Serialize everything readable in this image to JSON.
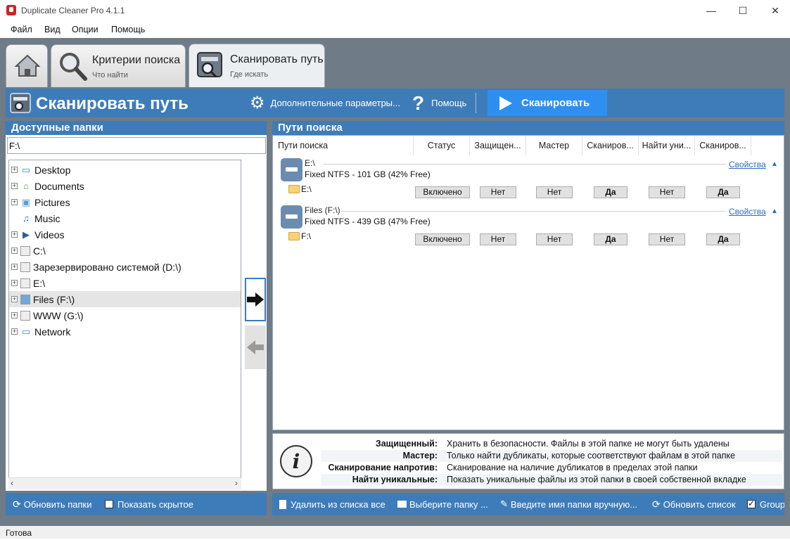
{
  "window": {
    "title": "Duplicate Cleaner Pro 4.1.1",
    "controls": [
      "minimize",
      "maximize",
      "close"
    ]
  },
  "menu": [
    "Файл",
    "Вид",
    "Опции",
    "Помощь"
  ],
  "tabs": [
    {
      "id": "home",
      "icon": "home-icon"
    },
    {
      "id": "criteria",
      "title": "Критерии поиска",
      "subtitle": "Что найти",
      "icon": "magnifier-icon"
    },
    {
      "id": "scan",
      "title": "Сканировать путь",
      "subtitle": "Где искать",
      "icon": "scan-drive-icon",
      "active": true
    }
  ],
  "header": {
    "title": "Сканировать путь",
    "advanced": "Дополнительные параметры...",
    "help": "Помощь",
    "scan": "Сканировать"
  },
  "left": {
    "heading": "Доступные папки",
    "path_value": "F:\\",
    "tree": [
      {
        "label": "Desktop",
        "icon": "desktop-icon",
        "expandable": true
      },
      {
        "label": "Documents",
        "icon": "documents-icon",
        "expandable": true
      },
      {
        "label": "Pictures",
        "icon": "pictures-icon",
        "expandable": true
      },
      {
        "label": "Music",
        "icon": "music-icon",
        "expandable": false
      },
      {
        "label": "Videos",
        "icon": "videos-icon",
        "expandable": true
      },
      {
        "label": "C:\\",
        "icon": "drive-icon",
        "expandable": true
      },
      {
        "label": "Зарезервировано системой (D:\\)",
        "icon": "drive-icon",
        "expandable": true
      },
      {
        "label": "E:\\",
        "icon": "drive-icon",
        "expandable": true
      },
      {
        "label": "Files (F:\\)",
        "icon": "drive-icon",
        "expandable": true,
        "selected": true
      },
      {
        "label": "WWW (G:\\)",
        "icon": "drive-icon",
        "expandable": true
      },
      {
        "label": "Network",
        "icon": "network-icon",
        "expandable": true
      }
    ]
  },
  "right": {
    "heading": "Пути поиска",
    "columns": [
      "Пути поиска",
      "Статус",
      "Защищен...",
      "Мастер",
      "Сканиров...",
      "Найти уни...",
      "Сканиров..."
    ],
    "drives": [
      {
        "name": "E:\\",
        "info": "Fixed NTFS - 101 GB (42% Free)",
        "props": "Свойства",
        "folder": "E:\\",
        "status": "Включено",
        "protected": "Нет",
        "master": "Нет",
        "scan_against": "Да",
        "find_unique": "Нет",
        "scan_last": "Да"
      },
      {
        "name": "Files (F:\\)",
        "info": "Fixed NTFS - 439 GB (47% Free)",
        "props": "Свойства",
        "folder": "F:\\",
        "status": "Включено",
        "protected": "Нет",
        "master": "Нет",
        "scan_against": "Да",
        "find_unique": "Нет",
        "scan_last": "Да"
      }
    ]
  },
  "info": [
    {
      "label": "Защищенный:",
      "text": "Хранить в безопасности. Файлы в этой папке не могут быть удалены"
    },
    {
      "label": "Мастер:",
      "text": "Только найти дубликаты, которые соответствуют файлам в этой папке"
    },
    {
      "label": "Сканирование напротив:",
      "text": "Сканирование на наличие дубликатов в пределах этой папки"
    },
    {
      "label": "Найти уникальные:",
      "text": "Показать уникальные файлы из этой папки в своей собственной вкладке"
    }
  ],
  "bottom_left": {
    "refresh": "Обновить папки",
    "show_hidden": "Показать скрытое",
    "show_hidden_checked": false
  },
  "bottom_right": {
    "clear": "Удалить из списка все",
    "choose": "Выберите папку ...",
    "manual": "Введите имя папки вручную...",
    "refresh_list": "Обновить список",
    "group": "Group",
    "group_checked": true
  },
  "status": "Готова",
  "colors": {
    "accent": "#3e7cb9",
    "chrome": "#6f7b87",
    "scan_button": "#2f8ff0",
    "link": "#2a6bbf"
  }
}
